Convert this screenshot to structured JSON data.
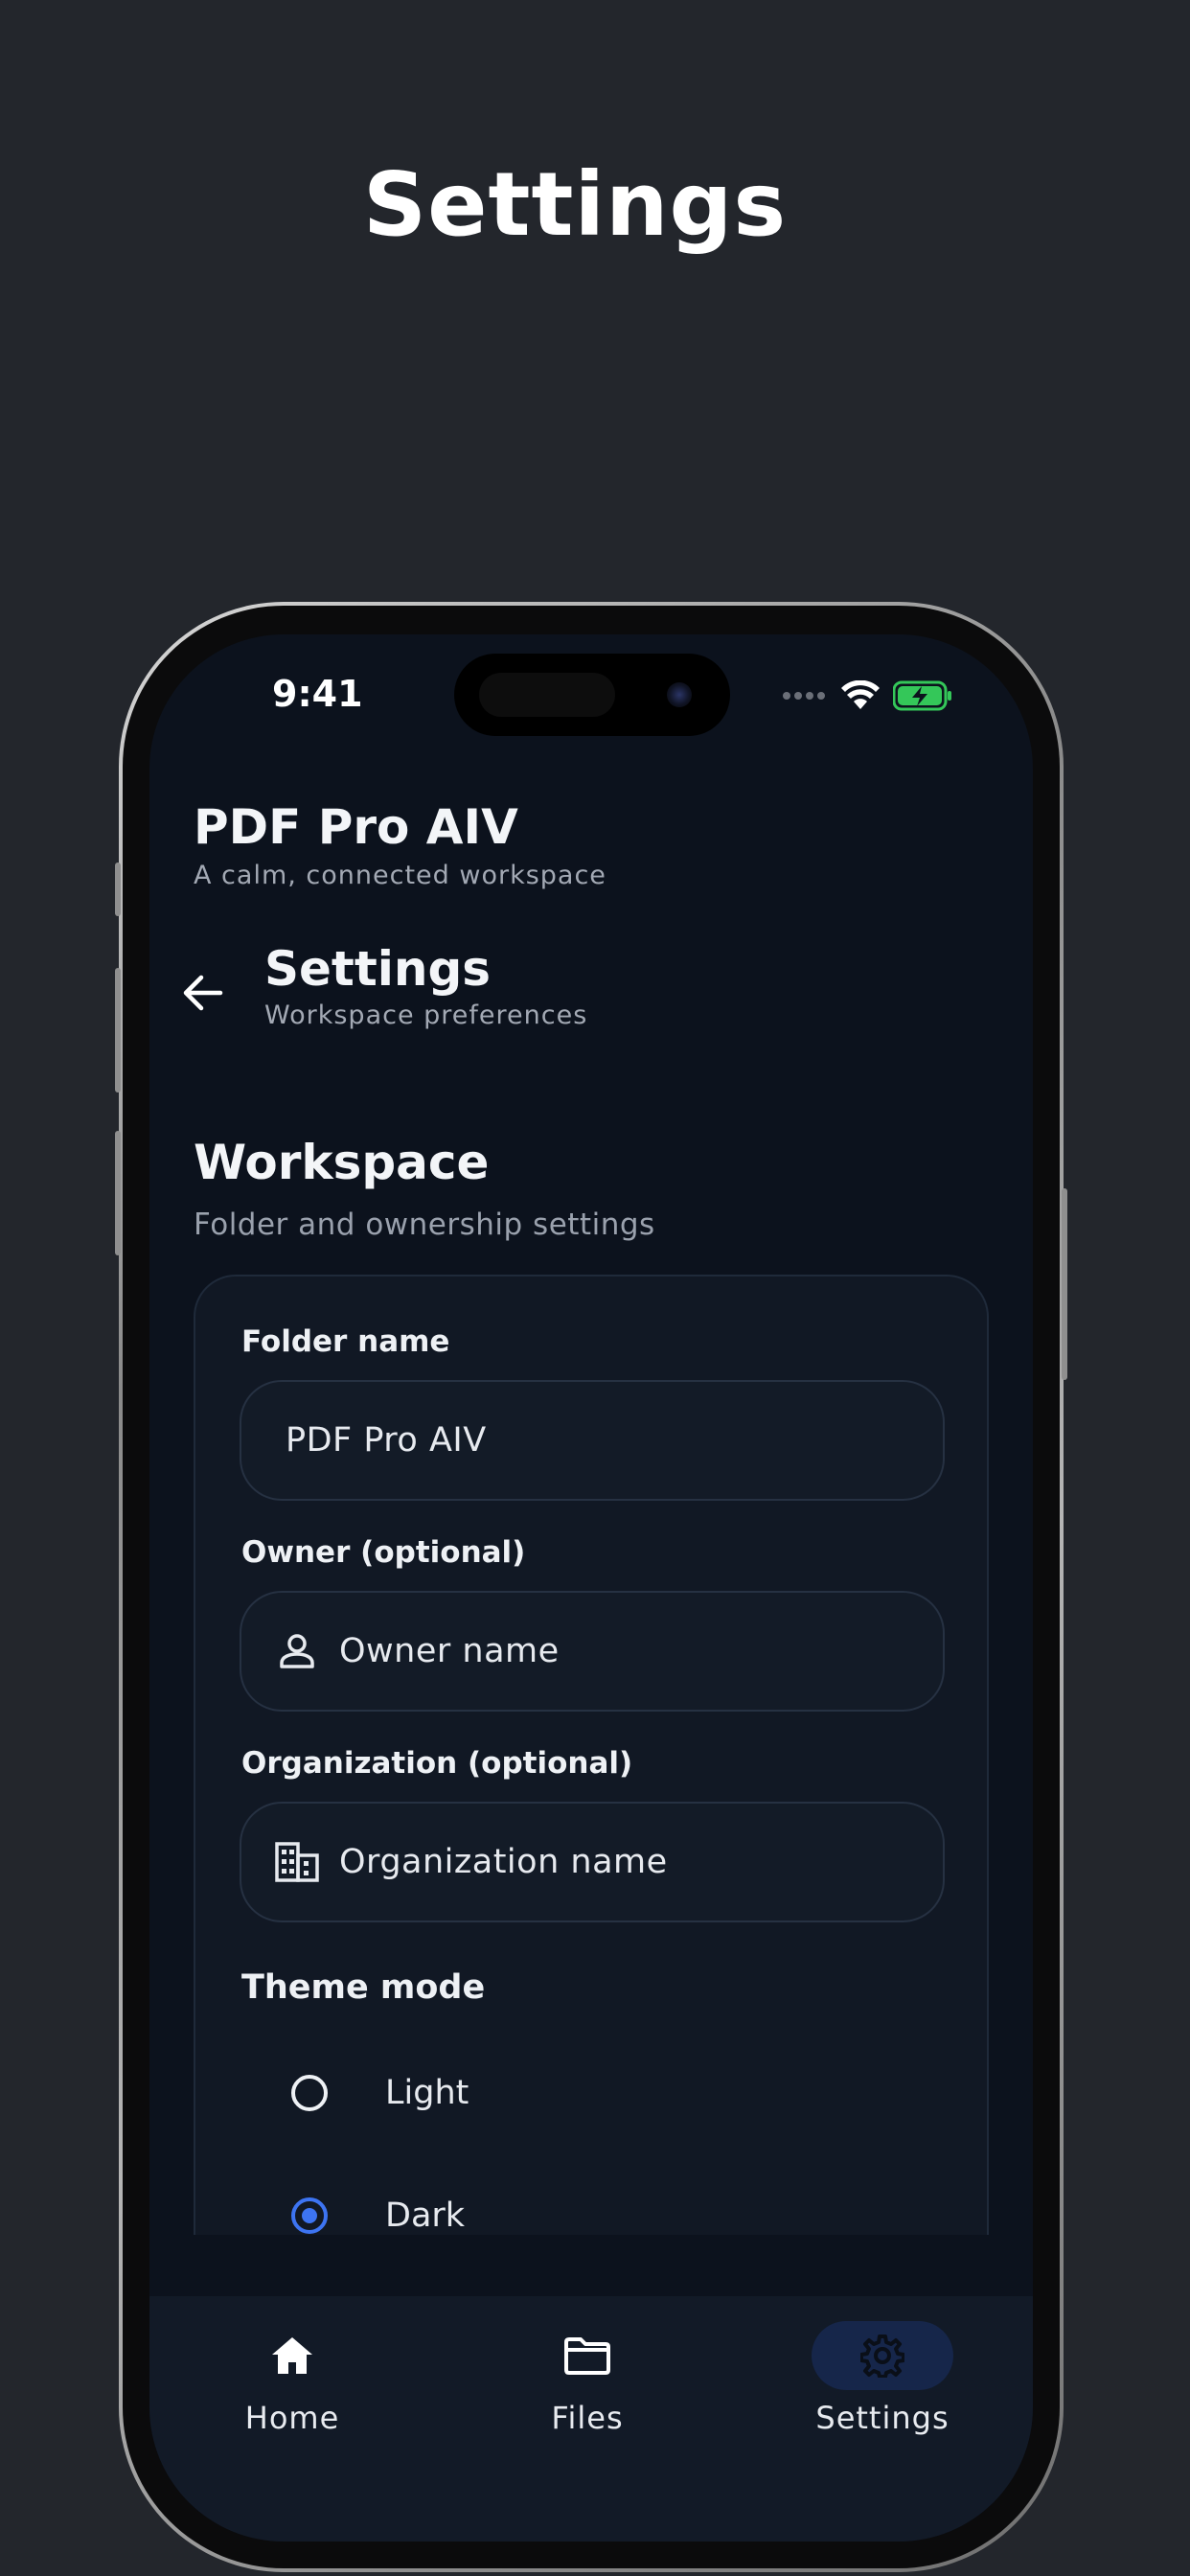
{
  "marketing": {
    "title": "Settings"
  },
  "status_bar": {
    "time": "9:41"
  },
  "header": {
    "app_name": "PDF Pro AIV",
    "tagline": "A calm, connected workspace"
  },
  "screen": {
    "title": "Settings",
    "subtitle": "Workspace preferences"
  },
  "workspace": {
    "title": "Workspace",
    "subtitle": "Folder and ownership settings",
    "folder_label": "Folder name",
    "folder_value": "PDF Pro AIV",
    "owner_label": "Owner (optional)",
    "owner_placeholder": "Owner name",
    "org_label": "Organization (optional)",
    "org_placeholder": "Organization name",
    "theme_label": "Theme mode",
    "theme_options": [
      {
        "label": "Light",
        "selected": false
      },
      {
        "label": "Dark",
        "selected": true
      }
    ]
  },
  "nav": {
    "items": [
      {
        "label": "Home",
        "icon": "home-icon",
        "active": false
      },
      {
        "label": "Files",
        "icon": "folder-icon",
        "active": false
      },
      {
        "label": "Settings",
        "icon": "gear-icon",
        "active": true
      }
    ]
  },
  "colors": {
    "background": "#23262c",
    "screen": "#0c121d",
    "accent": "#3d74f2",
    "active_nav": "#16264a"
  }
}
